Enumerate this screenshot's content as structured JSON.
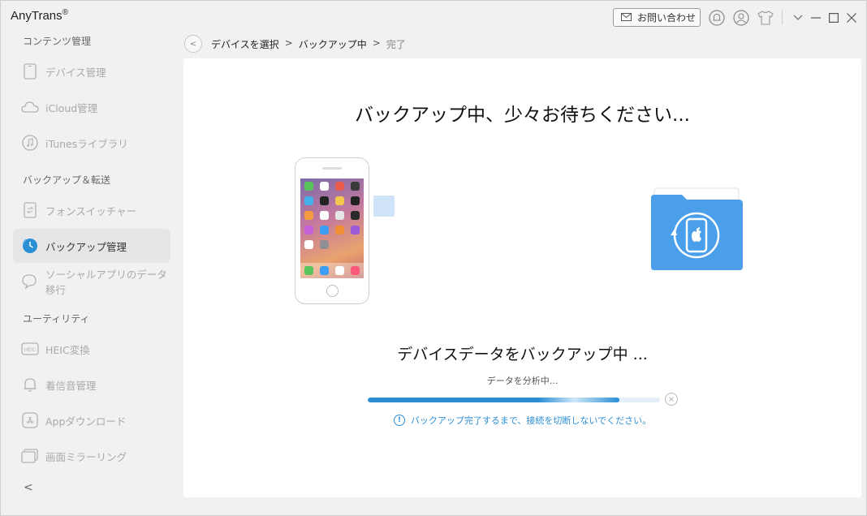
{
  "app": {
    "title": "AnyTrans",
    "title_mark": "®"
  },
  "titlebar": {
    "contact_label": "お問い合わせ",
    "icons": [
      "bell-icon",
      "user-icon",
      "tshirt-icon",
      "chevron-down-icon",
      "minimize-icon",
      "maximize-icon",
      "close-icon"
    ]
  },
  "sidebar": {
    "sections": [
      {
        "label": "コンテンツ管理"
      },
      {
        "label": "バックアップ＆転送"
      },
      {
        "label": "ユーティリティ"
      }
    ],
    "items": [
      {
        "label": "デバイス管理",
        "icon": "device-icon"
      },
      {
        "label": "iCloud管理",
        "icon": "cloud-icon"
      },
      {
        "label": "iTunesライブラリ",
        "icon": "music-icon"
      },
      {
        "label": "フォンスイッチャー",
        "icon": "phone-switch-icon"
      },
      {
        "label": "バックアップ管理",
        "icon": "backup-clock-icon",
        "active": true
      },
      {
        "label": "ソーシャルアプリのデータ移行",
        "icon": "chat-icon"
      },
      {
        "label": "HEIC変換",
        "icon": "heic-icon"
      },
      {
        "label": "着信音管理",
        "icon": "bell-icon"
      },
      {
        "label": "Appダウンロード",
        "icon": "app-store-icon"
      },
      {
        "label": "画面ミラーリング",
        "icon": "mirror-icon"
      }
    ],
    "collapse_label": "<"
  },
  "breadcrumb": {
    "back": "<",
    "step1": "デバイスを選択",
    "sep": ">",
    "step2": "バックアップ中",
    "step3": "完了"
  },
  "main": {
    "heading": "バックアップ中、少々お待ちください...",
    "status": "デバイスデータをバックアップ中 ...",
    "sub_status": "データを分析中...",
    "progress": 0.86,
    "warning": "バックアップ完了するまで、接続を切断しないでください。",
    "warning_icon": "!",
    "cancel_icon": "×"
  },
  "colors": {
    "accent": "#2c8fd6",
    "folder": "#4a9eea",
    "active_bg": "#e6e6e8"
  }
}
